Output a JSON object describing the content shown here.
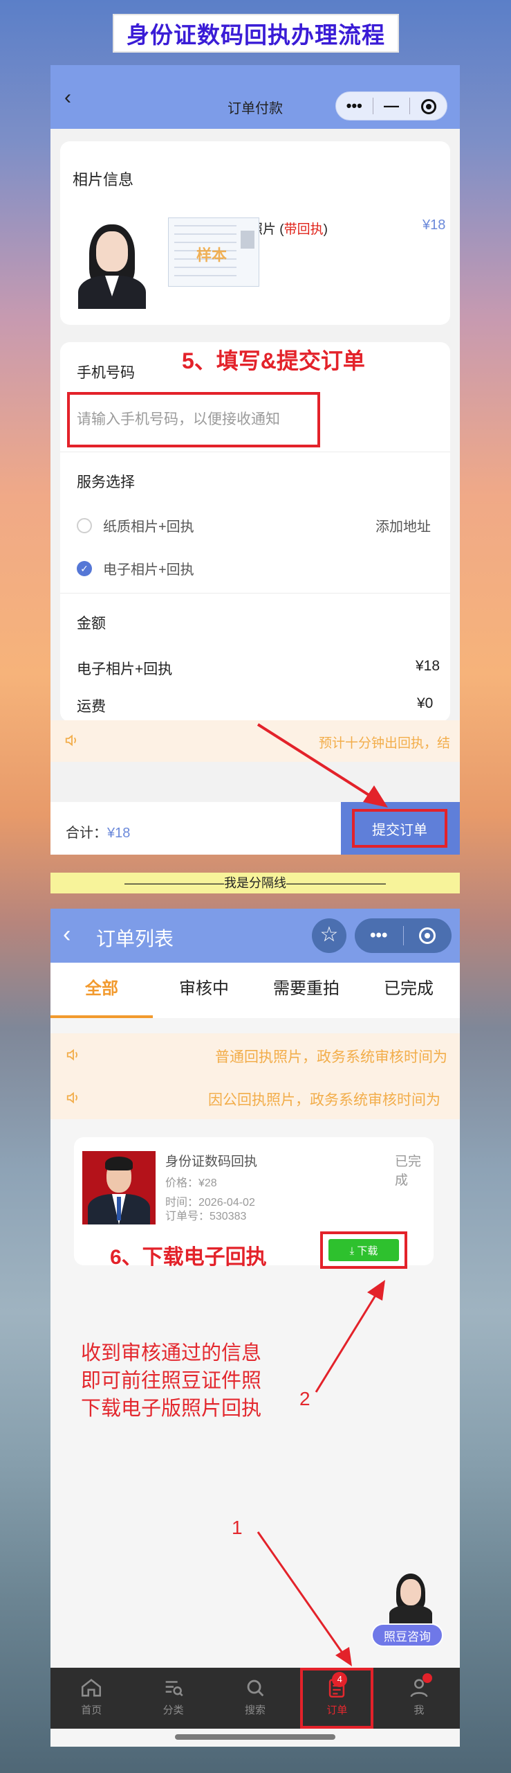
{
  "title_banner": "身份证数码回执办理流程",
  "screen1": {
    "nav_title": "订单付款",
    "capsule_more": "•••",
    "capsule_min": "—",
    "photo_section_title": "相片信息",
    "product_name_prefix": "深圳市身份证照片 (",
    "product_name_highlight": "带回执",
    "product_name_suffix": ")",
    "product_price": "¥18",
    "sample_stamp": "样本",
    "phone_label": "手机号码",
    "step_annotation": "5、填写&提交订单",
    "phone_placeholder": "请输入手机号码，以便接收通知",
    "service_label": "服务选择",
    "options": [
      {
        "label": "纸质相片+回执",
        "selected": false,
        "extra": "添加地址"
      },
      {
        "label": "电子相片+回执",
        "selected": true,
        "extra": ""
      }
    ],
    "amount_label": "金额",
    "amount_rows": [
      {
        "label": "电子相片+回执",
        "value": "¥18"
      },
      {
        "label": "运费",
        "value": "¥0"
      }
    ],
    "notice": "预计十分钟出回执，结",
    "total_label": "合计：",
    "total_amount": "¥18",
    "submit_label": "提交订单"
  },
  "separator_text": "————————我是分隔线————————",
  "screen2": {
    "nav_title": "订单列表",
    "tabs": [
      "全部",
      "审核中",
      "需要重拍",
      "已完成"
    ],
    "active_tab": 0,
    "notices": [
      "普通回执照片，政务系统审核时间为",
      "因公回执照片，政务系统审核时间为"
    ],
    "order": {
      "title": "身份证数码回执",
      "status": "已完成",
      "price": "价格：¥28",
      "time": "时间：2026-04-02",
      "order_no": "订单号：530383",
      "download_label": "⤓ 下载"
    },
    "step_annotation": "6、下载电子回执",
    "instruction_lines": [
      "收到审核通过的信息",
      "即可前往照豆证件照",
      "下载电子版照片回执"
    ],
    "marker_2": "2",
    "marker_1": "1",
    "consult_label": "照豆咨询",
    "tabbar": [
      {
        "label": "首页",
        "icon": "home-icon"
      },
      {
        "label": "分类",
        "icon": "category-icon"
      },
      {
        "label": "搜索",
        "icon": "search-icon"
      },
      {
        "label": "订单",
        "icon": "order-icon",
        "badge": "4"
      },
      {
        "label": "我",
        "icon": "user-icon"
      }
    ]
  },
  "colors": {
    "nav_blue": "#7d9ce8",
    "annotation_red": "#e3222a",
    "accent_orange": "#f29a2e",
    "download_green": "#2ec12e",
    "title_purple": "#3a1cd6"
  }
}
